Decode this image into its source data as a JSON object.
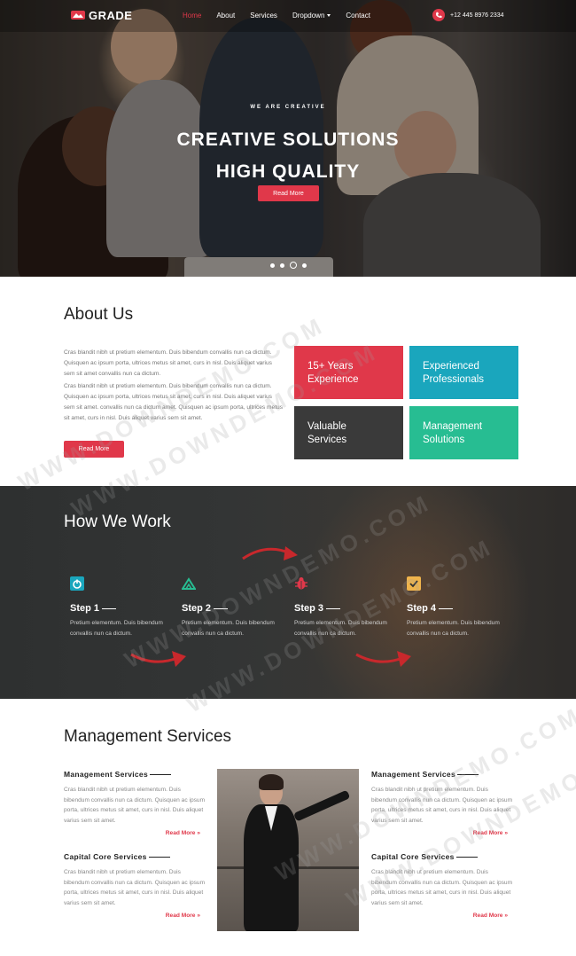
{
  "nav": {
    "brand": "GRADE",
    "items": [
      {
        "label": "Home",
        "active": true
      },
      {
        "label": "About",
        "active": false
      },
      {
        "label": "Services",
        "active": false
      },
      {
        "label": "Dropdown",
        "active": false,
        "has_caret": true
      },
      {
        "label": "Contact",
        "active": false
      }
    ],
    "phone": "+12 445 8976 2334",
    "icons": {
      "brand": "logo-mark-icon",
      "phone": "phone-icon"
    }
  },
  "hero": {
    "kicker": "WE ARE CREATIVE",
    "title_line1": "CREATIVE SOLUTIONS",
    "title_line2": "HIGH QUALITY",
    "button": "Read More",
    "slides": 4,
    "active_slide": 3
  },
  "about": {
    "title": "About Us",
    "p1": "Cras blandit nibh ut pretium elementum. Duis bibendum convallis nun ca dictum. Quisquen ac ipsum porta, ultrices metus sit amet, curs in nisl. Duis aliquet varius sem sit amet convallis nun ca dictum.",
    "p2": "Cras blandit nibh ut pretium elementum. Duis bibendum convallis nun ca dictum. Quisquen ac ipsum porta, ultrices metus sit amet, curs in nisl. Duis aliquet varius sem sit amet. convallis nun ca dictum amet. Quisquen ac ipsum porta, ultrices metus sit amet, curs in nisl. Duis aliquet varius sem sit amet.",
    "button": "Read More",
    "tiles": [
      {
        "line1": "15+ Years",
        "line2": "Experience",
        "color": "#e0384a"
      },
      {
        "line1": "Experienced",
        "line2": "Professionals",
        "color": "#1aa6bd"
      },
      {
        "line1": "Valuable",
        "line2": "Services",
        "color": "#3a3a3a"
      },
      {
        "line1": "Management",
        "line2": "Solutions",
        "color": "#27bd92"
      }
    ]
  },
  "how": {
    "title": "How We Work",
    "steps": [
      {
        "title": "Step 1",
        "text": "Pretium elementum. Duis bibendum convallis nun ca dictum.",
        "icon": "power-icon",
        "color": "#1aa6bd"
      },
      {
        "title": "Step 2",
        "text": "Pretium elementum. Duis bibendum convallis nun ca dictum.",
        "icon": "peak-icon",
        "color": "#27bd92"
      },
      {
        "title": "Step 3",
        "text": "Pretium elementum. Duis bibendum convallis nun ca dictum.",
        "icon": "bug-icon",
        "color": "#e0384a"
      },
      {
        "title": "Step 4",
        "text": "Pretium elementum. Duis bibendum convallis nun ca dictum.",
        "icon": "checkbox-icon",
        "color": "#f0b44c"
      }
    ]
  },
  "mgmt": {
    "title": "Management Services",
    "left": [
      {
        "title": "Management Services",
        "text": "Cras blandit nibh ut pretium elementum. Duis bibendum convallis nun ca dictum. Quisquen ac ipsum porta, ultrices metus sit amet, curs in nisl. Duis aliquet varius sem sit amet.",
        "more": "Read More"
      },
      {
        "title": "Capital Core Services",
        "text": "Cras blandit nibh ut pretium elementum. Duis bibendum convallis nun ca dictum. Quisquen ac ipsum porta, ultrices metus sit amet, curs in nisl. Duis aliquet varius sem sit amet.",
        "more": "Read More"
      }
    ],
    "right": [
      {
        "title": "Management Services",
        "text": "Cras blandit nibh ut pretium elementum. Duis bibendum convallis nun ca dictum. Quisquen ac ipsum porta, ultrices metus sit amet, curs in nisl. Duis aliquet varius sem sit amet.",
        "more": "Read More"
      },
      {
        "title": "Capital Core Services",
        "text": "Cras blandit nibh ut pretium elementum. Duis bibendum convallis nun ca dictum. Quisquen ac ipsum porta, ultrices metus sit amet, curs in nisl. Duis aliquet varius sem sit amet.",
        "more": "Read More"
      }
    ]
  },
  "watermark": "WWW.DOWNDEMO.COM",
  "colors": {
    "accent": "#e0384a",
    "teal": "#1aa6bd",
    "green": "#27bd92",
    "dark": "#3a3a3a"
  }
}
